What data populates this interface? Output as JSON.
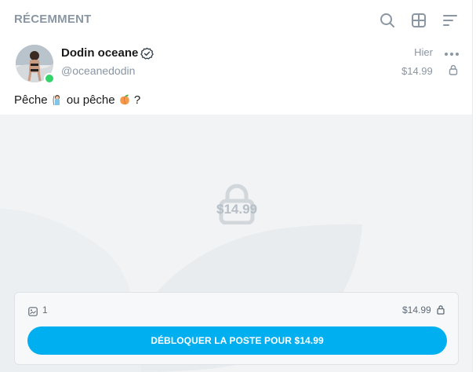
{
  "header": {
    "title": "RÉCEMMENT",
    "icons": [
      "search-icon",
      "grid-view-icon",
      "sort-icon"
    ]
  },
  "post": {
    "author_name": "Dodin oceane",
    "author_handle": "@oceanedodin",
    "verified": true,
    "online": true,
    "date": "Hier",
    "price": "$14.99",
    "text_part1": "Pêche ",
    "text_part2": " ou pêche ",
    "text_part3": " ?",
    "emoji1": "person-fishing-emoji",
    "emoji2": "peach-emoji"
  },
  "media": {
    "locked_price": "$14.99"
  },
  "unlock_panel": {
    "photo_count": "1",
    "price": "$14.99",
    "button_label": "DÉBLOQUER LA POSTE POUR $14.99"
  },
  "colors": {
    "accent": "#00aff0",
    "muted_text": "#8a96a3",
    "online": "#33d46a"
  }
}
